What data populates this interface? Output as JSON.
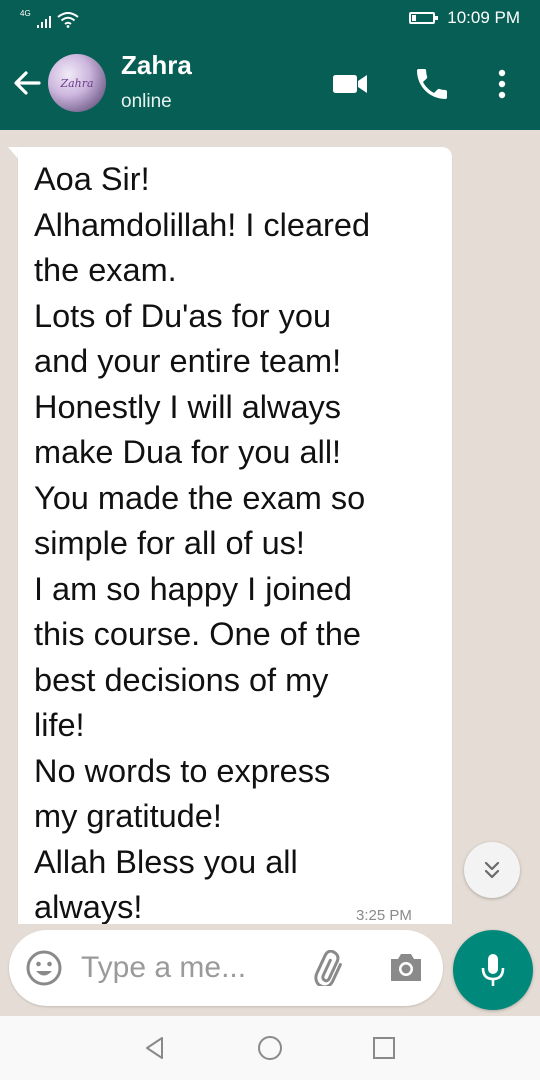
{
  "status_bar": {
    "network": "4G",
    "time": "10:09 PM",
    "icons": [
      "signal-icon",
      "wifi-icon",
      "battery-icon"
    ]
  },
  "header": {
    "back_icon": "arrow-left-icon",
    "avatar_text": "Zahra",
    "contact_name": "Zahra",
    "contact_status": "online",
    "actions": [
      "video-camera-icon",
      "phone-icon",
      "more-vert-icon"
    ]
  },
  "message": {
    "lines": [
      "Aoa Sir!",
      "Alhamdolillah! I cleared",
      "the exam.",
      "Lots of Du'as for you",
      "and your entire team!",
      "Honestly I will always",
      "make Dua for you all!",
      "You made the exam so",
      "simple for all of us!",
      "I am so happy I joined",
      "this course. One of the",
      "best decisions of my",
      "life!",
      "No words to express",
      "my gratitude!",
      "Allah Bless you all",
      "always!"
    ],
    "time": "3:25 PM"
  },
  "scroll_down_icon": "double-chevron-down-icon",
  "input_bar": {
    "placeholder": "Type a me...",
    "icons": [
      "emoji-icon",
      "attach-icon",
      "camera-icon",
      "mic-icon"
    ]
  },
  "nav_bar": {
    "icons": [
      "nav-back-icon",
      "nav-home-icon",
      "nav-recents-icon"
    ]
  },
  "colors": {
    "header": "#075e54",
    "chat_background": "#e5ddd5",
    "bubble": "#ffffff",
    "mic_button": "#00897b"
  }
}
